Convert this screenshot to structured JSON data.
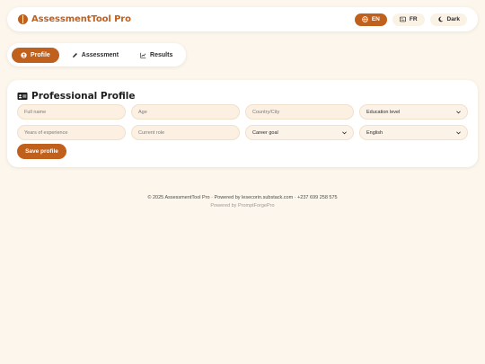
{
  "brand": {
    "name": "AssessmentTool Pro",
    "icon": "brain-icon",
    "color": "#c0601d"
  },
  "topbar": {
    "lang_en": "EN",
    "lang_fr": "FR",
    "theme": "Dark",
    "active_lang": "EN"
  },
  "tabs": [
    {
      "label": "Profile",
      "icon": "user-circle-icon",
      "active": true
    },
    {
      "label": "Assessment",
      "icon": "pencil-icon",
      "active": false
    },
    {
      "label": "Results",
      "icon": "chart-line-icon",
      "active": false
    }
  ],
  "profile": {
    "title": "Professional Profile",
    "title_icon": "id-card-icon",
    "fields": {
      "full_name": "Full name",
      "age": "Age",
      "location": "Country/City",
      "education": "Education level",
      "experience": "Years of experience",
      "current_role": "Current role",
      "career_goal": "Career goal",
      "language": "English"
    },
    "save_label": "Save profile"
  },
  "footer": {
    "line1": "© 2025 AssessmentTool Pro · Powered by lesecorin.substack.com · +237 699 258 575",
    "line2": "Powered by PromptForgePro"
  },
  "colors": {
    "accent": "#c0601d",
    "background": "#fcf6ec",
    "input_bg": "#fbf0e2"
  }
}
